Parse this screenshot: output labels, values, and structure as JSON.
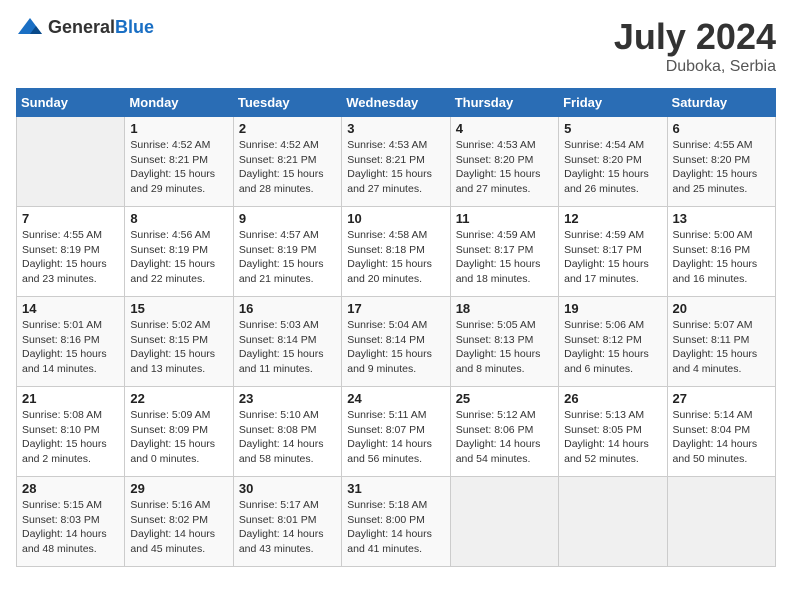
{
  "header": {
    "logo_general": "General",
    "logo_blue": "Blue",
    "month_year": "July 2024",
    "location": "Duboka, Serbia"
  },
  "weekdays": [
    "Sunday",
    "Monday",
    "Tuesday",
    "Wednesday",
    "Thursday",
    "Friday",
    "Saturday"
  ],
  "weeks": [
    [
      {
        "day": "",
        "info": ""
      },
      {
        "day": "1",
        "info": "Sunrise: 4:52 AM\nSunset: 8:21 PM\nDaylight: 15 hours\nand 29 minutes."
      },
      {
        "day": "2",
        "info": "Sunrise: 4:52 AM\nSunset: 8:21 PM\nDaylight: 15 hours\nand 28 minutes."
      },
      {
        "day": "3",
        "info": "Sunrise: 4:53 AM\nSunset: 8:21 PM\nDaylight: 15 hours\nand 27 minutes."
      },
      {
        "day": "4",
        "info": "Sunrise: 4:53 AM\nSunset: 8:20 PM\nDaylight: 15 hours\nand 27 minutes."
      },
      {
        "day": "5",
        "info": "Sunrise: 4:54 AM\nSunset: 8:20 PM\nDaylight: 15 hours\nand 26 minutes."
      },
      {
        "day": "6",
        "info": "Sunrise: 4:55 AM\nSunset: 8:20 PM\nDaylight: 15 hours\nand 25 minutes."
      }
    ],
    [
      {
        "day": "7",
        "info": "Sunrise: 4:55 AM\nSunset: 8:19 PM\nDaylight: 15 hours\nand 23 minutes."
      },
      {
        "day": "8",
        "info": "Sunrise: 4:56 AM\nSunset: 8:19 PM\nDaylight: 15 hours\nand 22 minutes."
      },
      {
        "day": "9",
        "info": "Sunrise: 4:57 AM\nSunset: 8:19 PM\nDaylight: 15 hours\nand 21 minutes."
      },
      {
        "day": "10",
        "info": "Sunrise: 4:58 AM\nSunset: 8:18 PM\nDaylight: 15 hours\nand 20 minutes."
      },
      {
        "day": "11",
        "info": "Sunrise: 4:59 AM\nSunset: 8:17 PM\nDaylight: 15 hours\nand 18 minutes."
      },
      {
        "day": "12",
        "info": "Sunrise: 4:59 AM\nSunset: 8:17 PM\nDaylight: 15 hours\nand 17 minutes."
      },
      {
        "day": "13",
        "info": "Sunrise: 5:00 AM\nSunset: 8:16 PM\nDaylight: 15 hours\nand 16 minutes."
      }
    ],
    [
      {
        "day": "14",
        "info": "Sunrise: 5:01 AM\nSunset: 8:16 PM\nDaylight: 15 hours\nand 14 minutes."
      },
      {
        "day": "15",
        "info": "Sunrise: 5:02 AM\nSunset: 8:15 PM\nDaylight: 15 hours\nand 13 minutes."
      },
      {
        "day": "16",
        "info": "Sunrise: 5:03 AM\nSunset: 8:14 PM\nDaylight: 15 hours\nand 11 minutes."
      },
      {
        "day": "17",
        "info": "Sunrise: 5:04 AM\nSunset: 8:14 PM\nDaylight: 15 hours\nand 9 minutes."
      },
      {
        "day": "18",
        "info": "Sunrise: 5:05 AM\nSunset: 8:13 PM\nDaylight: 15 hours\nand 8 minutes."
      },
      {
        "day": "19",
        "info": "Sunrise: 5:06 AM\nSunset: 8:12 PM\nDaylight: 15 hours\nand 6 minutes."
      },
      {
        "day": "20",
        "info": "Sunrise: 5:07 AM\nSunset: 8:11 PM\nDaylight: 15 hours\nand 4 minutes."
      }
    ],
    [
      {
        "day": "21",
        "info": "Sunrise: 5:08 AM\nSunset: 8:10 PM\nDaylight: 15 hours\nand 2 minutes."
      },
      {
        "day": "22",
        "info": "Sunrise: 5:09 AM\nSunset: 8:09 PM\nDaylight: 15 hours\nand 0 minutes."
      },
      {
        "day": "23",
        "info": "Sunrise: 5:10 AM\nSunset: 8:08 PM\nDaylight: 14 hours\nand 58 minutes."
      },
      {
        "day": "24",
        "info": "Sunrise: 5:11 AM\nSunset: 8:07 PM\nDaylight: 14 hours\nand 56 minutes."
      },
      {
        "day": "25",
        "info": "Sunrise: 5:12 AM\nSunset: 8:06 PM\nDaylight: 14 hours\nand 54 minutes."
      },
      {
        "day": "26",
        "info": "Sunrise: 5:13 AM\nSunset: 8:05 PM\nDaylight: 14 hours\nand 52 minutes."
      },
      {
        "day": "27",
        "info": "Sunrise: 5:14 AM\nSunset: 8:04 PM\nDaylight: 14 hours\nand 50 minutes."
      }
    ],
    [
      {
        "day": "28",
        "info": "Sunrise: 5:15 AM\nSunset: 8:03 PM\nDaylight: 14 hours\nand 48 minutes."
      },
      {
        "day": "29",
        "info": "Sunrise: 5:16 AM\nSunset: 8:02 PM\nDaylight: 14 hours\nand 45 minutes."
      },
      {
        "day": "30",
        "info": "Sunrise: 5:17 AM\nSunset: 8:01 PM\nDaylight: 14 hours\nand 43 minutes."
      },
      {
        "day": "31",
        "info": "Sunrise: 5:18 AM\nSunset: 8:00 PM\nDaylight: 14 hours\nand 41 minutes."
      },
      {
        "day": "",
        "info": ""
      },
      {
        "day": "",
        "info": ""
      },
      {
        "day": "",
        "info": ""
      }
    ]
  ]
}
